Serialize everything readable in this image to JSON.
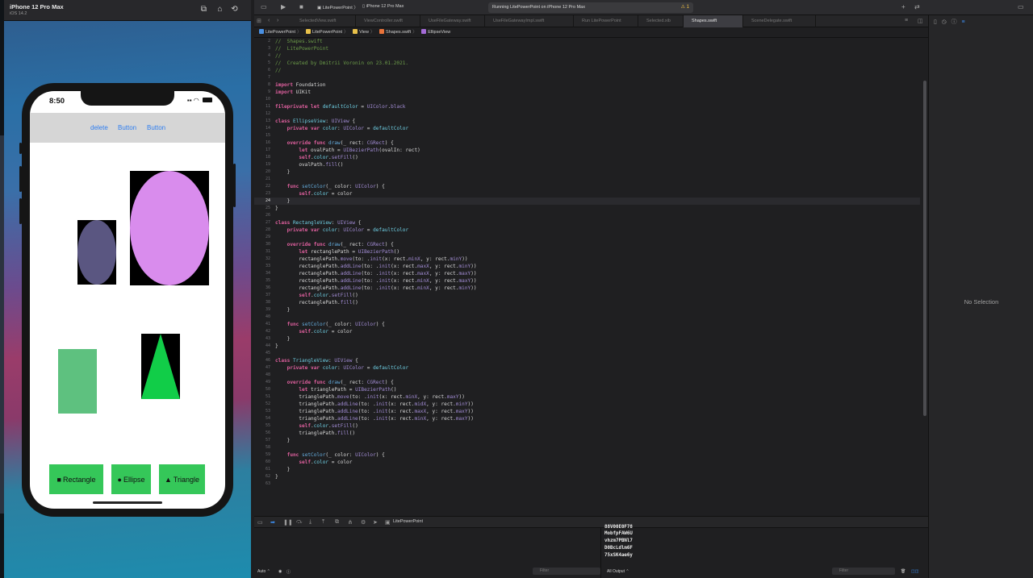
{
  "simulator": {
    "device_name": "iPhone 12 Pro Max",
    "os_version": "iOS 14.2",
    "phone": {
      "time": "8:50",
      "nav_buttons": [
        "delete",
        "Button",
        "Button"
      ],
      "action_buttons": [
        {
          "icon": "■",
          "label": "Rectangle"
        },
        {
          "icon": "●",
          "label": "Ellipse"
        },
        {
          "icon": "▲",
          "label": "Triangle"
        }
      ],
      "colors": {
        "small_ellipse": "#5a5681",
        "large_ellipse": "#d98ced",
        "rectangle": "#5ec17f",
        "triangle": "#11cd48",
        "nav_bar": "#d6d6d6",
        "nav_button_text": "#2f7ef0",
        "action_button": "#35c759"
      }
    }
  },
  "xcode": {
    "toolbar": {
      "scheme": "LitePowerPoint",
      "destination": "iPhone 12 Pro Max",
      "run_status": "Running LitePowerPoint on iPhone 12 Pro Max",
      "warning_count": "1"
    },
    "tabs": [
      "SelectedView.swift",
      "ViewController.swift",
      "UseFileGateway.swift",
      "UseFileGatewayImpl.swift",
      "Run LitePowerPoint",
      "Selected.xib",
      "Shapes.swift",
      "SceneDelegate.swift"
    ],
    "active_tab": "Shapes.swift",
    "breadcrumb": [
      "LitePowerPoint",
      "LitePowerPoint",
      "View",
      "Shapes.swift",
      "EllipseView"
    ],
    "current_line": 24,
    "code": [
      {
        "n": "2",
        "t": [
          [
            "cm",
            "//  Shapes.swift"
          ]
        ]
      },
      {
        "n": "3",
        "t": [
          [
            "cm",
            "//  LitePowerPoint"
          ]
        ]
      },
      {
        "n": "4",
        "t": [
          [
            "cm",
            "//"
          ]
        ]
      },
      {
        "n": "5",
        "t": [
          [
            "cm",
            "//  Created by Dmitrii Voronin on 23.01.2021."
          ]
        ]
      },
      {
        "n": "6",
        "t": [
          [
            "cm",
            "//"
          ]
        ]
      },
      {
        "n": "7",
        "t": []
      },
      {
        "n": "8",
        "t": [
          [
            "kw",
            "import"
          ],
          [
            "tx",
            " Foundation"
          ]
        ]
      },
      {
        "n": "9",
        "t": [
          [
            "kw",
            "import"
          ],
          [
            "tx",
            " UIKit"
          ]
        ]
      },
      {
        "n": "10",
        "t": []
      },
      {
        "n": "11",
        "t": [
          [
            "kw",
            "fileprivate let"
          ],
          [
            "ty",
            " defaultColor"
          ],
          [
            "tx",
            " = "
          ],
          [
            "mb",
            "UIColor"
          ],
          [
            "tx",
            "."
          ],
          [
            "mb",
            "black"
          ]
        ]
      },
      {
        "n": "12",
        "t": []
      },
      {
        "n": "13",
        "t": [
          [
            "kw",
            "class"
          ],
          [
            "ty",
            " EllipseView"
          ],
          [
            "tx",
            ": "
          ],
          [
            "mb",
            "UIView"
          ],
          [
            "tx",
            " {"
          ]
        ]
      },
      {
        "n": "14",
        "t": [
          [
            "kw",
            "    private var"
          ],
          [
            "ty",
            " color"
          ],
          [
            "tx",
            ": "
          ],
          [
            "mb",
            "UIColor"
          ],
          [
            "tx",
            " = "
          ],
          [
            "ty",
            "defaultColor"
          ]
        ]
      },
      {
        "n": "15",
        "t": []
      },
      {
        "n": "16",
        "t": [
          [
            "kw",
            "    override func"
          ],
          [
            "fn",
            " draw"
          ],
          [
            "tx",
            "(_ rect: "
          ],
          [
            "mb",
            "CGRect"
          ],
          [
            "tx",
            ") {"
          ]
        ]
      },
      {
        "n": "17",
        "t": [
          [
            "kw",
            "        let"
          ],
          [
            "tx",
            " ovalPath = "
          ],
          [
            "mb",
            "UIBezierPath"
          ],
          [
            "tx",
            "(ovalIn: rect)"
          ]
        ]
      },
      {
        "n": "18",
        "t": [
          [
            "kw",
            "        self"
          ],
          [
            "tx",
            "."
          ],
          [
            "ty",
            "color"
          ],
          [
            "tx",
            "."
          ],
          [
            "mb",
            "setFill"
          ],
          [
            "tx",
            "()"
          ]
        ]
      },
      {
        "n": "19",
        "t": [
          [
            "tx",
            "        ovalPath."
          ],
          [
            "mb",
            "fill"
          ],
          [
            "tx",
            "()"
          ]
        ]
      },
      {
        "n": "20",
        "t": [
          [
            "tx",
            "    }"
          ]
        ]
      },
      {
        "n": "21",
        "t": []
      },
      {
        "n": "22",
        "t": [
          [
            "kw",
            "    func"
          ],
          [
            "fn",
            " setColor"
          ],
          [
            "tx",
            "(_ color: "
          ],
          [
            "mb",
            "UIColor"
          ],
          [
            "tx",
            ") {"
          ]
        ]
      },
      {
        "n": "23",
        "t": [
          [
            "kw",
            "        self"
          ],
          [
            "tx",
            "."
          ],
          [
            "ty",
            "color"
          ],
          [
            "tx",
            " = color"
          ]
        ]
      },
      {
        "n": "24",
        "t": [
          [
            "tx",
            "    }"
          ]
        ]
      },
      {
        "n": "25",
        "t": [
          [
            "tx",
            "}"
          ]
        ]
      },
      {
        "n": "26",
        "t": []
      },
      {
        "n": "27",
        "t": [
          [
            "kw",
            "class"
          ],
          [
            "ty",
            " RectangleView"
          ],
          [
            "tx",
            ": "
          ],
          [
            "mb",
            "UIView"
          ],
          [
            "tx",
            " {"
          ]
        ]
      },
      {
        "n": "28",
        "t": [
          [
            "kw",
            "    private var"
          ],
          [
            "ty",
            " color"
          ],
          [
            "tx",
            ": "
          ],
          [
            "mb",
            "UIColor"
          ],
          [
            "tx",
            " = "
          ],
          [
            "ty",
            "defaultColor"
          ]
        ]
      },
      {
        "n": "29",
        "t": []
      },
      {
        "n": "30",
        "t": [
          [
            "kw",
            "    override func"
          ],
          [
            "fn",
            " draw"
          ],
          [
            "tx",
            "(_ rect: "
          ],
          [
            "mb",
            "CGRect"
          ],
          [
            "tx",
            ") {"
          ]
        ]
      },
      {
        "n": "31",
        "t": [
          [
            "kw",
            "        let"
          ],
          [
            "tx",
            " rectanglePath = "
          ],
          [
            "mb",
            "UIBezierPath"
          ],
          [
            "tx",
            "()"
          ]
        ]
      },
      {
        "n": "32",
        "t": [
          [
            "tx",
            "        rectanglePath."
          ],
          [
            "mb",
            "move"
          ],
          [
            "tx",
            "(to: ."
          ],
          [
            "mb",
            "init"
          ],
          [
            "tx",
            "(x: rect."
          ],
          [
            "mb",
            "minX"
          ],
          [
            "tx",
            ", y: rect."
          ],
          [
            "mb",
            "minY"
          ],
          [
            "tx",
            "))"
          ]
        ]
      },
      {
        "n": "33",
        "t": [
          [
            "tx",
            "        rectanglePath."
          ],
          [
            "mb",
            "addLine"
          ],
          [
            "tx",
            "(to: ."
          ],
          [
            "mb",
            "init"
          ],
          [
            "tx",
            "(x: rect."
          ],
          [
            "mb",
            "maxX"
          ],
          [
            "tx",
            ", y: rect."
          ],
          [
            "mb",
            "minY"
          ],
          [
            "tx",
            "))"
          ]
        ]
      },
      {
        "n": "34",
        "t": [
          [
            "tx",
            "        rectanglePath."
          ],
          [
            "mb",
            "addLine"
          ],
          [
            "tx",
            "(to: ."
          ],
          [
            "mb",
            "init"
          ],
          [
            "tx",
            "(x: rect."
          ],
          [
            "mb",
            "maxX"
          ],
          [
            "tx",
            ", y: rect."
          ],
          [
            "mb",
            "maxY"
          ],
          [
            "tx",
            "))"
          ]
        ]
      },
      {
        "n": "35",
        "t": [
          [
            "tx",
            "        rectanglePath."
          ],
          [
            "mb",
            "addLine"
          ],
          [
            "tx",
            "(to: ."
          ],
          [
            "mb",
            "init"
          ],
          [
            "tx",
            "(x: rect."
          ],
          [
            "mb",
            "minX"
          ],
          [
            "tx",
            ", y: rect."
          ],
          [
            "mb",
            "maxY"
          ],
          [
            "tx",
            "))"
          ]
        ]
      },
      {
        "n": "36",
        "t": [
          [
            "tx",
            "        rectanglePath."
          ],
          [
            "mb",
            "addLine"
          ],
          [
            "tx",
            "(to: ."
          ],
          [
            "mb",
            "init"
          ],
          [
            "tx",
            "(x: rect."
          ],
          [
            "mb",
            "minX"
          ],
          [
            "tx",
            ", y: rect."
          ],
          [
            "mb",
            "minY"
          ],
          [
            "tx",
            "))"
          ]
        ]
      },
      {
        "n": "37",
        "t": [
          [
            "kw",
            "        self"
          ],
          [
            "tx",
            "."
          ],
          [
            "ty",
            "color"
          ],
          [
            "tx",
            "."
          ],
          [
            "mb",
            "setFill"
          ],
          [
            "tx",
            "()"
          ]
        ]
      },
      {
        "n": "38",
        "t": [
          [
            "tx",
            "        rectanglePath."
          ],
          [
            "mb",
            "fill"
          ],
          [
            "tx",
            "()"
          ]
        ]
      },
      {
        "n": "39",
        "t": [
          [
            "tx",
            "    }"
          ]
        ]
      },
      {
        "n": "40",
        "t": []
      },
      {
        "n": "41",
        "t": [
          [
            "kw",
            "    func"
          ],
          [
            "fn",
            " setColor"
          ],
          [
            "tx",
            "(_ color: "
          ],
          [
            "mb",
            "UIColor"
          ],
          [
            "tx",
            ") {"
          ]
        ]
      },
      {
        "n": "42",
        "t": [
          [
            "kw",
            "        self"
          ],
          [
            "tx",
            "."
          ],
          [
            "ty",
            "color"
          ],
          [
            "tx",
            " = color"
          ]
        ]
      },
      {
        "n": "43",
        "t": [
          [
            "tx",
            "    }"
          ]
        ]
      },
      {
        "n": "44",
        "t": [
          [
            "tx",
            "}"
          ]
        ]
      },
      {
        "n": "45",
        "t": []
      },
      {
        "n": "46",
        "t": [
          [
            "kw",
            "class"
          ],
          [
            "ty",
            " TriangleView"
          ],
          [
            "tx",
            ": "
          ],
          [
            "mb",
            "UIView"
          ],
          [
            "tx",
            " {"
          ]
        ]
      },
      {
        "n": "47",
        "t": [
          [
            "kw",
            "    private var"
          ],
          [
            "ty",
            " color"
          ],
          [
            "tx",
            ": "
          ],
          [
            "mb",
            "UIColor"
          ],
          [
            "tx",
            " = "
          ],
          [
            "ty",
            "defaultColor"
          ]
        ]
      },
      {
        "n": "48",
        "t": []
      },
      {
        "n": "49",
        "t": [
          [
            "kw",
            "    override func"
          ],
          [
            "fn",
            " draw"
          ],
          [
            "tx",
            "(_ rect: "
          ],
          [
            "mb",
            "CGRect"
          ],
          [
            "tx",
            ") {"
          ]
        ]
      },
      {
        "n": "50",
        "t": [
          [
            "kw",
            "        let"
          ],
          [
            "tx",
            " trianglePath = "
          ],
          [
            "mb",
            "UIBezierPath"
          ],
          [
            "tx",
            "()"
          ]
        ]
      },
      {
        "n": "51",
        "t": [
          [
            "tx",
            "        trianglePath."
          ],
          [
            "mb",
            "move"
          ],
          [
            "tx",
            "(to: ."
          ],
          [
            "mb",
            "init"
          ],
          [
            "tx",
            "(x: rect."
          ],
          [
            "mb",
            "minX"
          ],
          [
            "tx",
            ", y: rect."
          ],
          [
            "mb",
            "maxY"
          ],
          [
            "tx",
            "))"
          ]
        ]
      },
      {
        "n": "52",
        "t": [
          [
            "tx",
            "        trianglePath."
          ],
          [
            "mb",
            "addLine"
          ],
          [
            "tx",
            "(to: ."
          ],
          [
            "mb",
            "init"
          ],
          [
            "tx",
            "(x: rect."
          ],
          [
            "mb",
            "midX"
          ],
          [
            "tx",
            ", y: rect."
          ],
          [
            "mb",
            "minY"
          ],
          [
            "tx",
            "))"
          ]
        ]
      },
      {
        "n": "53",
        "t": [
          [
            "tx",
            "        trianglePath."
          ],
          [
            "mb",
            "addLine"
          ],
          [
            "tx",
            "(to: ."
          ],
          [
            "mb",
            "init"
          ],
          [
            "tx",
            "(x: rect."
          ],
          [
            "mb",
            "maxX"
          ],
          [
            "tx",
            ", y: rect."
          ],
          [
            "mb",
            "maxY"
          ],
          [
            "tx",
            "))"
          ]
        ]
      },
      {
        "n": "54",
        "t": [
          [
            "tx",
            "        trianglePath."
          ],
          [
            "mb",
            "addLine"
          ],
          [
            "tx",
            "(to: ."
          ],
          [
            "mb",
            "init"
          ],
          [
            "tx",
            "(x: rect."
          ],
          [
            "mb",
            "minX"
          ],
          [
            "tx",
            ", y: rect."
          ],
          [
            "mb",
            "maxY"
          ],
          [
            "tx",
            "))"
          ]
        ]
      },
      {
        "n": "55",
        "t": [
          [
            "kw",
            "        self"
          ],
          [
            "tx",
            "."
          ],
          [
            "ty",
            "color"
          ],
          [
            "tx",
            "."
          ],
          [
            "mb",
            "setFill"
          ],
          [
            "tx",
            "()"
          ]
        ]
      },
      {
        "n": "56",
        "t": [
          [
            "tx",
            "        trianglePath."
          ],
          [
            "mb",
            "fill"
          ],
          [
            "tx",
            "()"
          ]
        ]
      },
      {
        "n": "57",
        "t": [
          [
            "tx",
            "    }"
          ]
        ]
      },
      {
        "n": "58",
        "t": []
      },
      {
        "n": "59",
        "t": [
          [
            "kw",
            "    func"
          ],
          [
            "fn",
            " setColor"
          ],
          [
            "tx",
            "(_ color: "
          ],
          [
            "mb",
            "UIColor"
          ],
          [
            "tx",
            ") {"
          ]
        ]
      },
      {
        "n": "60",
        "t": [
          [
            "kw",
            "        self"
          ],
          [
            "tx",
            "."
          ],
          [
            "ty",
            "color"
          ],
          [
            "tx",
            " = color"
          ]
        ]
      },
      {
        "n": "61",
        "t": [
          [
            "tx",
            "    }"
          ]
        ]
      },
      {
        "n": "62",
        "t": [
          [
            "tx",
            "}"
          ]
        ]
      },
      {
        "n": "63",
        "t": []
      }
    ],
    "debug_bar": {
      "target": "LitePowerPoint"
    },
    "console": {
      "lines": [
        "MobfpFAW6U",
        "vhzm7PBNl7",
        "D0BcLdlm6F",
        "75xSK4ae6y"
      ],
      "variables_mode": "Auto",
      "output_mode": "All Output",
      "filter_placeholder": "Filter"
    },
    "inspector": {
      "empty_label": "No Selection"
    }
  }
}
